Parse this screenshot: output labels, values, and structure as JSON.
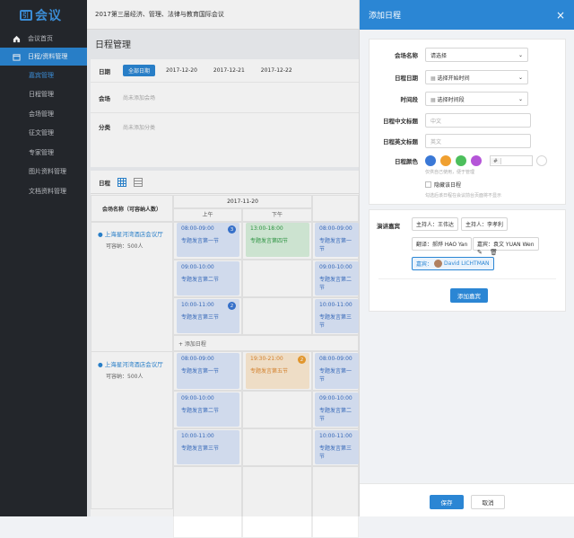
{
  "app": {
    "logo": "会议",
    "top_title": "2017第三届经济、管理、法律与教育国际会议"
  },
  "sidebar": {
    "items": [
      {
        "label": "会议首页",
        "icon": "home-icon"
      },
      {
        "label": "日程/资料管理",
        "icon": "calendar-icon"
      }
    ],
    "sub_items": [
      "嘉宾管理",
      "日程管理",
      "会场管理",
      "征文管理",
      "专家管理",
      "图片资料管理",
      "文档资料管理"
    ]
  },
  "main": {
    "page_title": "日程管理",
    "filter": {
      "date_label": "日期",
      "dates": [
        "全部日期",
        "2017-12-20",
        "2017-12-21",
        "2017-12-22"
      ],
      "venue_label": "会场",
      "venue_value": "尚未添加会场",
      "category_label": "分类",
      "category_value": "尚未添加分类"
    },
    "schedule": {
      "label": "日程",
      "venue_header": "会场名称（可容纳人数）",
      "day_header": "2017-11-20",
      "am": "上午",
      "pm": "下午",
      "add_schedule": "+ 添加日程",
      "venues": [
        {
          "name": "上海星河湾酒店会议厅",
          "capacity": "可容纳：500人"
        },
        {
          "name": "上海星河湾酒店会议厅",
          "capacity": "可容纳：500人"
        }
      ],
      "events": [
        {
          "time": "08:00-09:00",
          "title": "专题发言第一节",
          "badge": "3"
        },
        {
          "time": "13:00-18:00",
          "title": "专题发言第四节"
        },
        {
          "time": "08:00-09:00",
          "title": "专题发言第一节"
        },
        {
          "time": "09:00-10:00",
          "title": "专题发言第二节"
        },
        {
          "time": "09:00-10:00",
          "title": "专题发言第二节"
        },
        {
          "time": "10:00-11:00",
          "title": "专题发言第三节",
          "badge": "2"
        },
        {
          "time": "10:00-11:00",
          "title": "专题发言第三节"
        },
        {
          "time": "08:00-09:00",
          "title": "专题发言第一节"
        },
        {
          "time": "19:30-21:00",
          "title": "专题发言第五节",
          "badge": "2"
        },
        {
          "time": "08:00-09:00",
          "title": "专题发言第一节"
        },
        {
          "time": "09:00-10:00",
          "title": "专题发言第二节"
        },
        {
          "time": "09:00-10:00",
          "title": "专题发言第二节"
        },
        {
          "time": "10:00-11:00",
          "title": "专题发言第三节"
        },
        {
          "time": "10:00-11:00",
          "title": "专题发言第三节"
        }
      ]
    }
  },
  "panel": {
    "title": "添加日程",
    "close": "×",
    "form": {
      "venue_label": "会场名称",
      "venue_value": "请选择",
      "date_label": "日程日期",
      "date_value": "选择开始时间",
      "slot_label": "时间段",
      "slot_value": "选择时间段",
      "cn_title_label": "日程中文标题",
      "cn_title_placeholder": "中文",
      "en_title_label": "日程英文标题",
      "en_title_placeholder": "英文",
      "color_label": "日程颜色",
      "color_hint": "仅供自己使用，便于管理",
      "hex_prefix": "#",
      "hide_label": "隐藏该日程",
      "hide_hint": "勾选后该日程在会议前台页面将不显示",
      "colors": [
        "#3a78d6",
        "#f0a030",
        "#4cbf5c",
        "#b555d8"
      ]
    },
    "guests": {
      "label": "演讲嘉宾",
      "tags": [
        "主持人：王伟达",
        "主持人：李孝利",
        "翻译：郝烨 HAO Yan",
        "嘉宾：袁文 YUAN Wen"
      ],
      "selected_prefix": "嘉宾：",
      "selected_name": "David LICHTMAN",
      "add_button": "添加嘉宾"
    },
    "footer": {
      "save": "保存",
      "cancel": "取消"
    }
  }
}
